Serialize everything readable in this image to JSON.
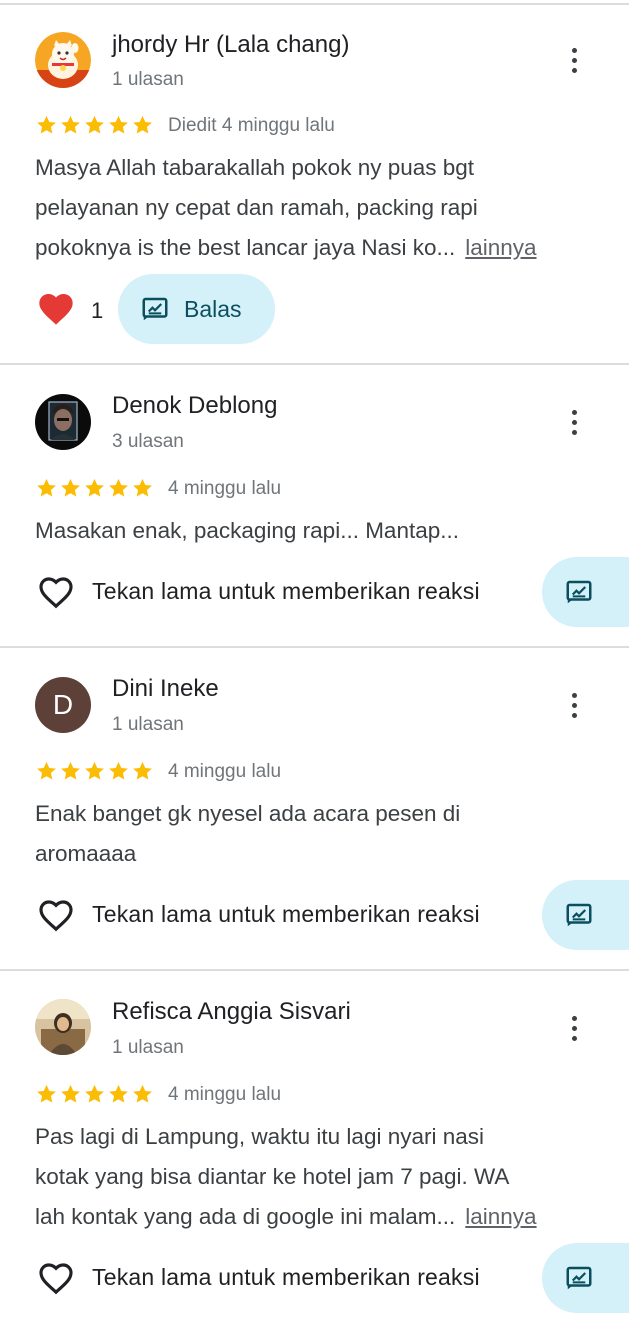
{
  "reviews": [
    {
      "name": "jhordy Hr (Lala chang)",
      "count": "1 ulasan",
      "avatar_icon": "lucky-cat-avatar",
      "stars": 5,
      "date": "Diedit 4 minggu lalu",
      "text_lines": [
        "Masya Allah tabarakallah pokok ny puas bgt",
        "pelayanan ny cepat dan ramah, packing rapi",
        "pokoknya is the best lancar jaya Nasi ko..."
      ],
      "more": "lainnya",
      "reaction_count": "1",
      "reply_label": "Balas"
    },
    {
      "name": "Denok Deblong",
      "count": "3 ulasan",
      "avatar_icon": "photo-avatar",
      "stars": 5,
      "date": "4 minggu lalu",
      "text_lines": [
        "Masakan enak, packaging rapi... Mantap..."
      ],
      "react_hint": "Tekan lama untuk memberikan reaksi"
    },
    {
      "name": "Dini Ineke",
      "count": "1 ulasan",
      "avatar_letter": "D",
      "stars": 5,
      "date": "4 minggu lalu",
      "text_lines": [
        "Enak banget gk nyesel ada acara pesen di",
        "aromaaaa"
      ],
      "react_hint": "Tekan lama untuk memberikan reaksi"
    },
    {
      "name": "Refisca Anggia Sisvari",
      "count": "1 ulasan",
      "avatar_icon": "photo-avatar",
      "stars": 5,
      "date": "4 minggu lalu",
      "text_lines": [
        "Pas lagi di Lampung, waktu itu lagi nyari nasi",
        "kotak yang bisa diantar ke hotel jam 7 pagi. WA",
        "lah kontak yang ada di google ini malam..."
      ],
      "more": "lainnya",
      "react_hint": "Tekan lama untuk memberikan reaksi"
    }
  ],
  "colors": {
    "star": "#fbbc04",
    "heart": "#e53935",
    "reply_bg": "#d4f0f9",
    "reply_fg": "#0b4f5e",
    "divider": "#dadce0",
    "avatar_letter_bg": "#5d4037"
  }
}
